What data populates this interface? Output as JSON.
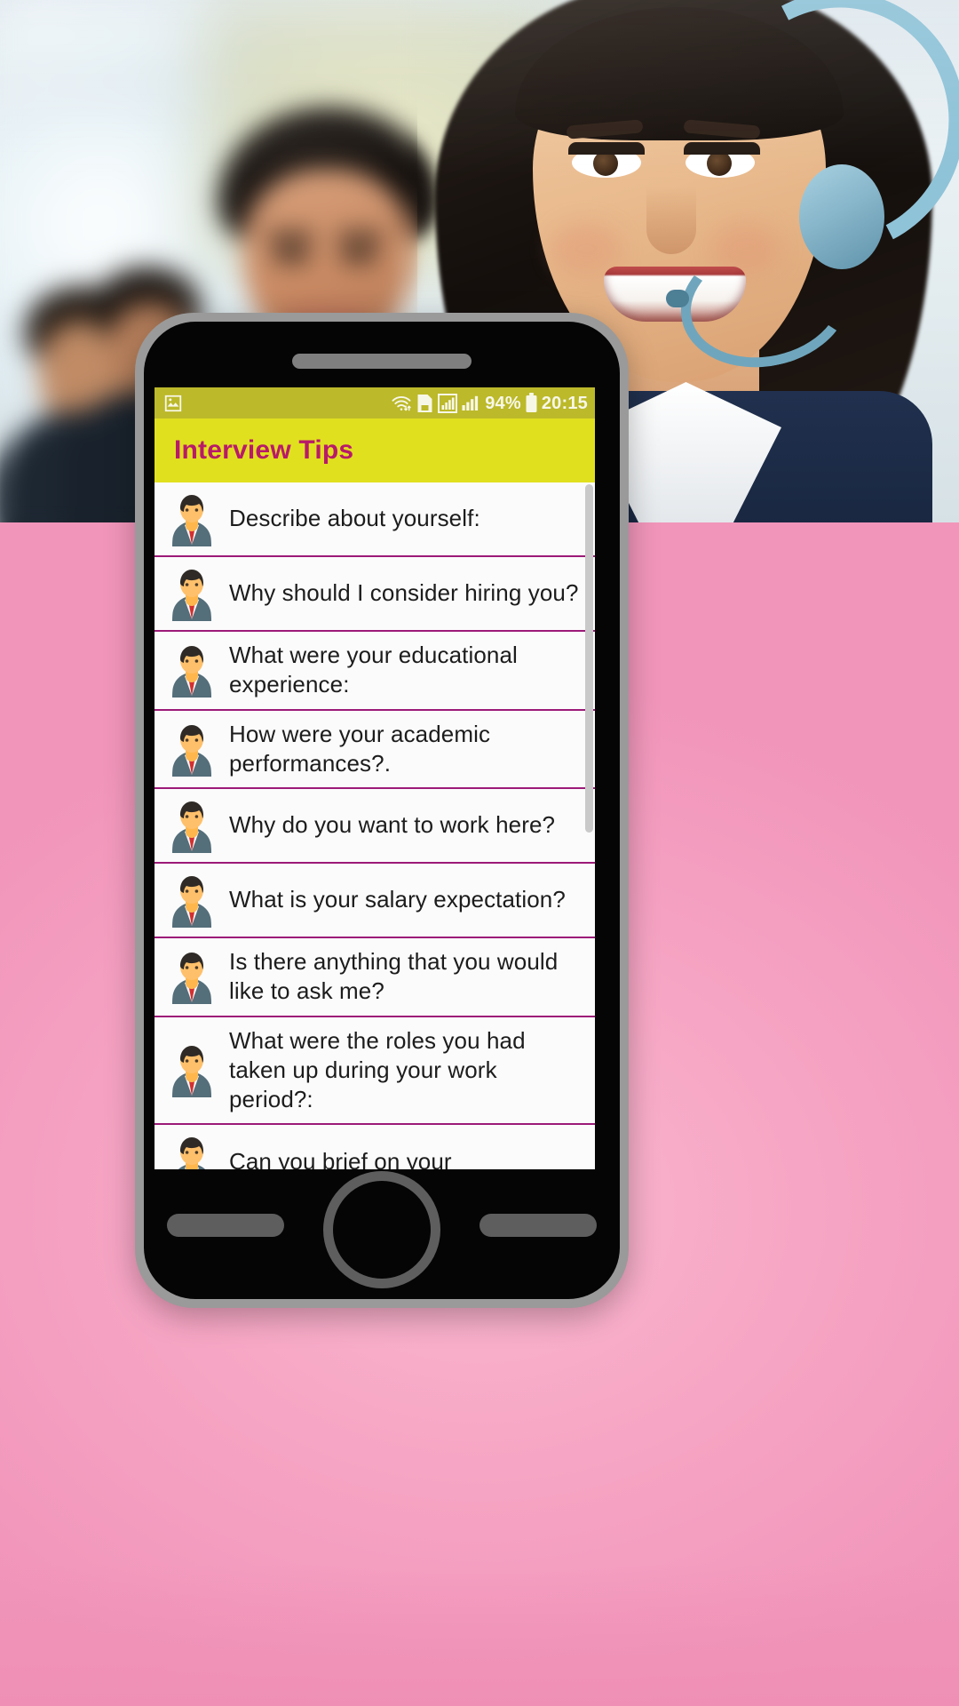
{
  "app": {
    "status_bar": {
      "image_icon": "image-icon",
      "wifi_icon": "wifi-transfer-icon",
      "sim_icon": "sim-card-icon",
      "signal1_icon": "signal-bars-boxed-icon",
      "signal2_icon": "signal-bars-icon",
      "battery_percent": "94%",
      "battery_icon": "battery-icon",
      "clock": "20:15"
    },
    "appbar": {
      "title": "Interview Tips",
      "title_color": "#b81a6a",
      "bg_color": "#e1e01f"
    },
    "list": {
      "divider_color": "#9c1a78",
      "avatar_icon": "businessman-avatar-icon",
      "items": [
        {
          "label": "Describe about yourself:"
        },
        {
          "label": "Why should I consider hiring you?"
        },
        {
          "label": "What were your educational\nexperience:"
        },
        {
          "label": "How were your academic\nperformances?."
        },
        {
          "label": "Why do you want to work here?"
        },
        {
          "label": "What is your salary expectation?"
        },
        {
          "label": "Is there anything that you would\nlike to ask me?"
        },
        {
          "label": "What were the roles you had\ntaken up during your work\nperiod?:"
        },
        {
          "label": "Can you brief on your"
        }
      ],
      "scrollbar": "vertical-scrollbar"
    }
  },
  "device": {
    "speaker_grill": "speaker-grill",
    "home_button": "home-button",
    "soft_key_left": "soft-key-left",
    "soft_key_right": "soft-key-right"
  },
  "background": {
    "photo": "call-center-team-photo",
    "band_color": "#f7a8c5"
  }
}
